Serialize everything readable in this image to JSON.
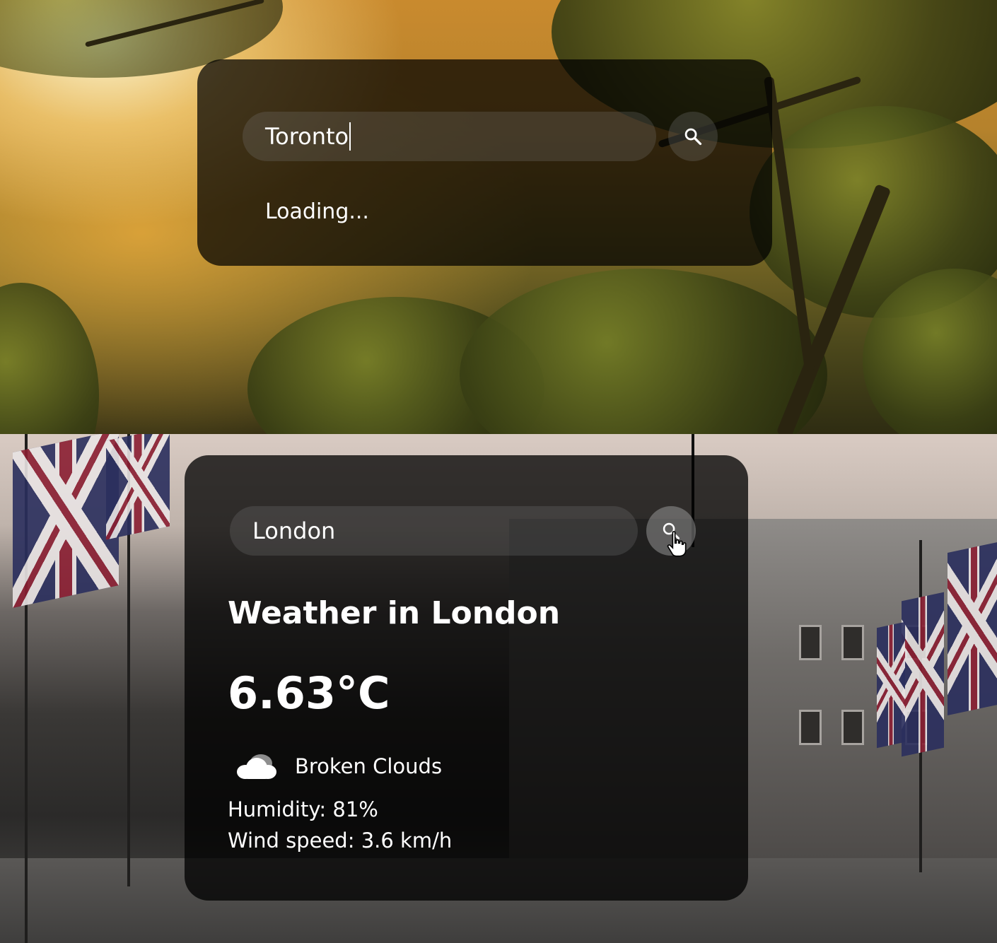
{
  "top_panel": {
    "search": {
      "value": "Toronto",
      "icon": "search-icon"
    },
    "status": {
      "loading_text": "Loading..."
    }
  },
  "bottom_panel": {
    "search": {
      "value": "London",
      "icon": "search-icon"
    },
    "weather": {
      "title": "Weather in London",
      "temperature": "6.63°C",
      "condition_icon": "cloud-icon",
      "description": "Broken Clouds",
      "humidity": "Humidity: 81%",
      "wind_speed": "Wind speed: 3.6 km/h"
    }
  },
  "colors": {
    "card_bg": "#000000",
    "text": "#ffffff",
    "input_bg": "#7d7d7d",
    "flag_red": "#8b1f33",
    "flag_blue": "#2b2f5e"
  }
}
